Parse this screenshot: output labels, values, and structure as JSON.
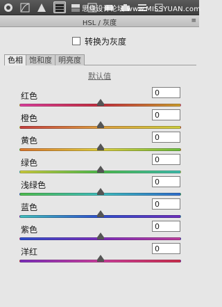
{
  "toolbar": {
    "tools": [
      {
        "icon": "aperture-icon"
      },
      {
        "icon": "tone-curve-icon"
      },
      {
        "icon": "detail-triangle-icon"
      },
      {
        "icon": "hsl-panel-icon",
        "active": true
      },
      {
        "icon": "split-toning-icon"
      },
      {
        "icon": "lens-icon"
      },
      {
        "icon": "effects-icon"
      },
      {
        "icon": "camera-calibration-icon"
      },
      {
        "icon": "presets-icon"
      },
      {
        "icon": "snapshots-icon"
      }
    ],
    "watermark": "思缘设计论坛 www.MISSYUAN.com"
  },
  "panel": {
    "title": "HSL / 灰度",
    "menu_icon": "≡"
  },
  "grayscale": {
    "label": "转换为灰度",
    "checked": false
  },
  "tabs": [
    {
      "label": "色相",
      "active": true
    },
    {
      "label": "饱和度",
      "active": false
    },
    {
      "label": "明亮度",
      "active": false
    }
  ],
  "default_label": "默认值",
  "sliders": [
    {
      "label": "红色",
      "value": "0",
      "pos": 0.5,
      "gradient": [
        "#e040a0",
        "#c83040",
        "#d0a030"
      ]
    },
    {
      "label": "橙色",
      "value": "0",
      "pos": 0.5,
      "gradient": [
        "#c84040",
        "#e0a040",
        "#d0d040"
      ]
    },
    {
      "label": "黄色",
      "value": "0",
      "pos": 0.5,
      "gradient": [
        "#e07a30",
        "#e0d040",
        "#70c040"
      ]
    },
    {
      "label": "绿色",
      "value": "0",
      "pos": 0.5,
      "gradient": [
        "#d0d040",
        "#50c050",
        "#40c0b0"
      ]
    },
    {
      "label": "浅绿色",
      "value": "0",
      "pos": 0.5,
      "gradient": [
        "#50c050",
        "#40c0c0",
        "#3070d0"
      ]
    },
    {
      "label": "蓝色",
      "value": "0",
      "pos": 0.5,
      "gradient": [
        "#40c0c0",
        "#3050d0",
        "#7030c0"
      ]
    },
    {
      "label": "紫色",
      "value": "0",
      "pos": 0.5,
      "gradient": [
        "#3050d0",
        "#8030c0",
        "#c040a0"
      ]
    },
    {
      "label": "洋红",
      "value": "0",
      "pos": 0.5,
      "gradient": [
        "#8030c0",
        "#d040a0",
        "#d03050"
      ]
    }
  ]
}
